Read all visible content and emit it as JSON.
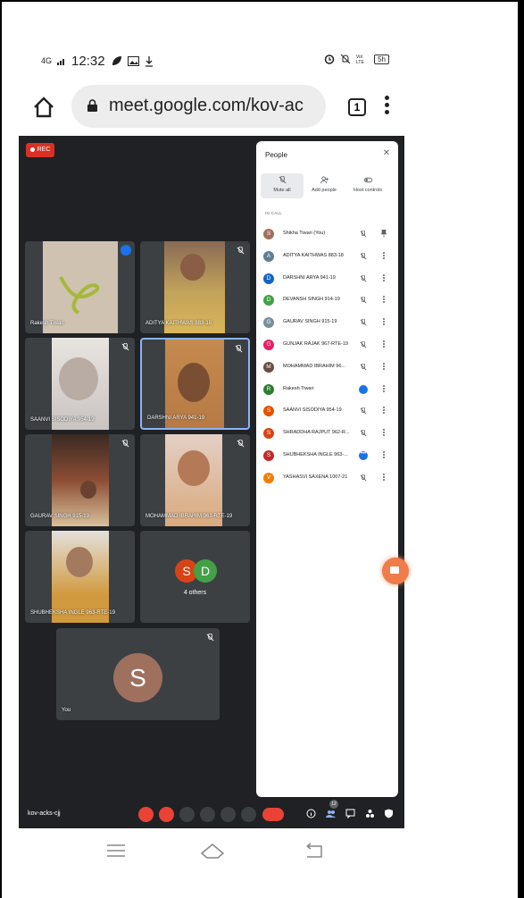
{
  "status_bar": {
    "network": "4G",
    "time": "12:32",
    "battery": "5h"
  },
  "browser": {
    "url": "meet.google.com/kov-ac",
    "tab_count": "1"
  },
  "meet": {
    "rec_label": "REC",
    "meeting_code": "kov-acks-cjj",
    "participants_badge": "12",
    "tiles": [
      {
        "name": "Rakesh Tiwari",
        "speaking": true
      },
      {
        "name": "ADITYA KAITHWAS 883-18"
      },
      {
        "name": "SAANVI SISODIYA 954-19"
      },
      {
        "name": "DARSHNI ARYA 941-19",
        "active": true
      },
      {
        "name": "GAURAV SINGH 915-19"
      },
      {
        "name": "MOHAMMAD IBRAHIM 961-RTE-19"
      },
      {
        "name": "SHUBHEKSHA INGLE 963-RTE-19"
      }
    ],
    "others_tile": {
      "initials": [
        "S",
        "D"
      ],
      "label": "4 others"
    },
    "you_tile": {
      "initial": "S",
      "label": "You"
    }
  },
  "people_panel": {
    "title": "People",
    "actions": [
      "Mute all",
      "Add people",
      "Host controls"
    ],
    "in_call_label": "IN CALL",
    "participants": [
      {
        "initial": "S",
        "name": "Shikha Tiwari (You)",
        "color": "#a0705f",
        "state": "pin"
      },
      {
        "initial": "A",
        "name": "ADITYA KAITHWAS 883-18",
        "color": "#5f7e97",
        "state": "muted"
      },
      {
        "initial": "D",
        "name": "DARSHNI ARYA 941-19",
        "color": "#1565c0",
        "state": "muted"
      },
      {
        "initial": "D",
        "name": "DEVANSH SINGH 914-19",
        "color": "#43a047",
        "state": "muted"
      },
      {
        "initial": "G",
        "name": "GAURAV SINGH 915-19",
        "color": "#78909c",
        "state": "muted"
      },
      {
        "initial": "G",
        "name": "GUNJAK RAJAK 967-RTE-19",
        "color": "#e91e63",
        "state": "muted"
      },
      {
        "initial": "M",
        "name": "MOHAMMAD IBRAHIM 96...",
        "color": "#6d4c41",
        "state": "muted"
      },
      {
        "initial": "R",
        "name": "Rakesh Tiwari",
        "color": "#2e7d32",
        "state": "speaking"
      },
      {
        "initial": "S",
        "name": "SAANVI SISODIYA 954-19",
        "color": "#e65100",
        "state": "muted"
      },
      {
        "initial": "S",
        "name": "SHRADDHA RAJPUT 962-R...",
        "color": "#d84315",
        "state": "muted"
      },
      {
        "initial": "S",
        "name": "SHUBHEKSHA INGLE 963-...",
        "color": "#c62828",
        "state": "dots"
      },
      {
        "initial": "V",
        "name": "YASHASVI SAXENA 1007-21",
        "color": "#f57c00",
        "state": "muted"
      }
    ]
  }
}
